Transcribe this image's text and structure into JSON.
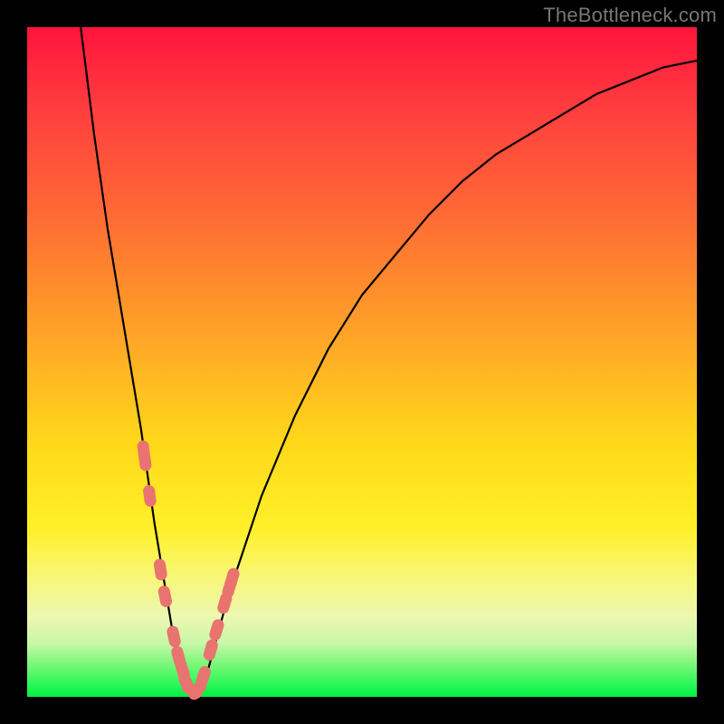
{
  "watermark": "TheBottleneck.com",
  "colors": {
    "grad_top": "#ff143c",
    "grad_bottom": "#00f040",
    "curve": "#000000",
    "marker": "#e9746f",
    "frame": "#000000"
  },
  "chart_data": {
    "type": "line",
    "title": "",
    "xlabel": "",
    "ylabel": "",
    "xlim": [
      0,
      100
    ],
    "ylim": [
      0,
      100
    ],
    "x": [
      8,
      10,
      12,
      14,
      15,
      16,
      17,
      18,
      19,
      20,
      21,
      22,
      23,
      24,
      25,
      27,
      30,
      35,
      40,
      45,
      50,
      55,
      60,
      65,
      70,
      75,
      80,
      85,
      90,
      95,
      100
    ],
    "y": [
      100,
      84,
      70,
      58,
      52,
      46,
      40,
      33,
      26,
      20,
      14,
      8,
      4,
      1,
      0,
      4,
      15,
      30,
      42,
      52,
      60,
      66,
      72,
      77,
      81,
      84,
      87,
      90,
      92,
      94,
      95
    ],
    "minimum_x": 25,
    "markers": {
      "note": "clustered pink capsule-shaped markers near the valley",
      "x": [
        17.5,
        18.3,
        19.9,
        20.6,
        21.9,
        22.6,
        23.2,
        23.8,
        24.6,
        25.4,
        26.3,
        27.4,
        28.3,
        29.5,
        30.4
      ],
      "y": [
        36,
        30,
        19,
        15,
        9,
        6,
        4,
        2,
        1,
        1,
        3,
        7,
        10,
        14,
        17
      ]
    }
  }
}
